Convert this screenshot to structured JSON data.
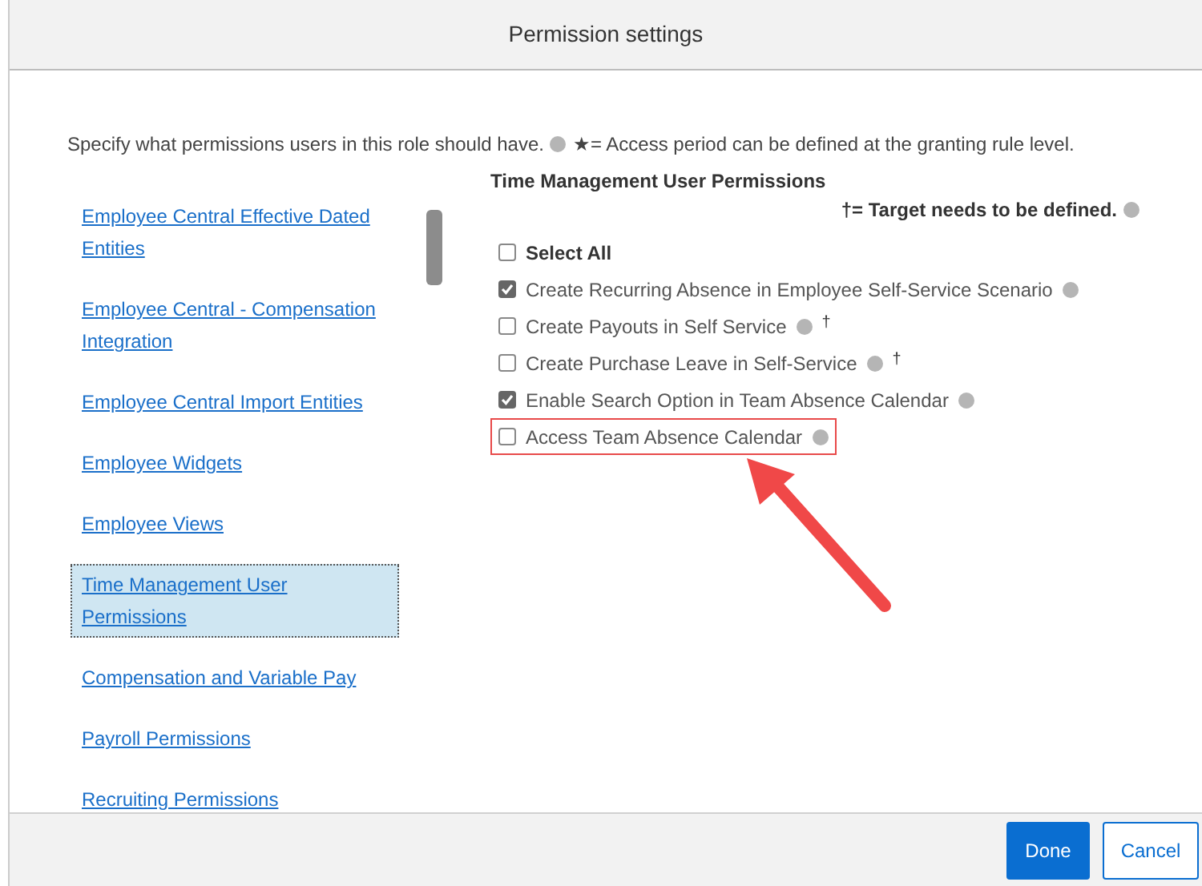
{
  "dialog": {
    "title": "Permission settings"
  },
  "intro": {
    "text": "Specify what permissions users in this role should have.",
    "note": "★= Access period can be defined at the granting rule level."
  },
  "categories": [
    {
      "label": "Employee Central Effective Dated Entities",
      "selected": false
    },
    {
      "label": "Employee Central - Compensation Integration",
      "selected": false
    },
    {
      "label": "Employee Central Import Entities",
      "selected": false
    },
    {
      "label": "Employee Widgets",
      "selected": false
    },
    {
      "label": "Employee Views",
      "selected": false
    },
    {
      "label": "Time Management User Permissions",
      "selected": true
    },
    {
      "label": "Compensation and Variable Pay",
      "selected": false
    },
    {
      "label": "Payroll Permissions",
      "selected": false
    },
    {
      "label": "Recruiting Permissions",
      "selected": false
    }
  ],
  "panel": {
    "title": "Time Management User Permissions",
    "legend": "†= Target needs to be defined.",
    "permissions": [
      {
        "kind": "select_all",
        "label": "Select All",
        "checked": false
      },
      {
        "kind": "permission",
        "label": "Create Recurring Absence in Employee Self-Service Scenario",
        "checked": true
      },
      {
        "kind": "permission",
        "label": "Create Payouts in Self Service",
        "checked": false,
        "mark": "†"
      },
      {
        "kind": "permission",
        "label": "Create Purchase Leave in Self-Service",
        "checked": false,
        "mark": "†"
      },
      {
        "kind": "permission",
        "label": "Enable Search Option in Team Absence Calendar",
        "checked": true
      },
      {
        "kind": "permission",
        "label": "Access Team Absence Calendar",
        "checked": false,
        "highlighted": true
      }
    ]
  },
  "footer": {
    "buttons": [
      {
        "label": "Done",
        "kind": "primary"
      },
      {
        "label": "Cancel",
        "kind": "secondary"
      }
    ]
  }
}
